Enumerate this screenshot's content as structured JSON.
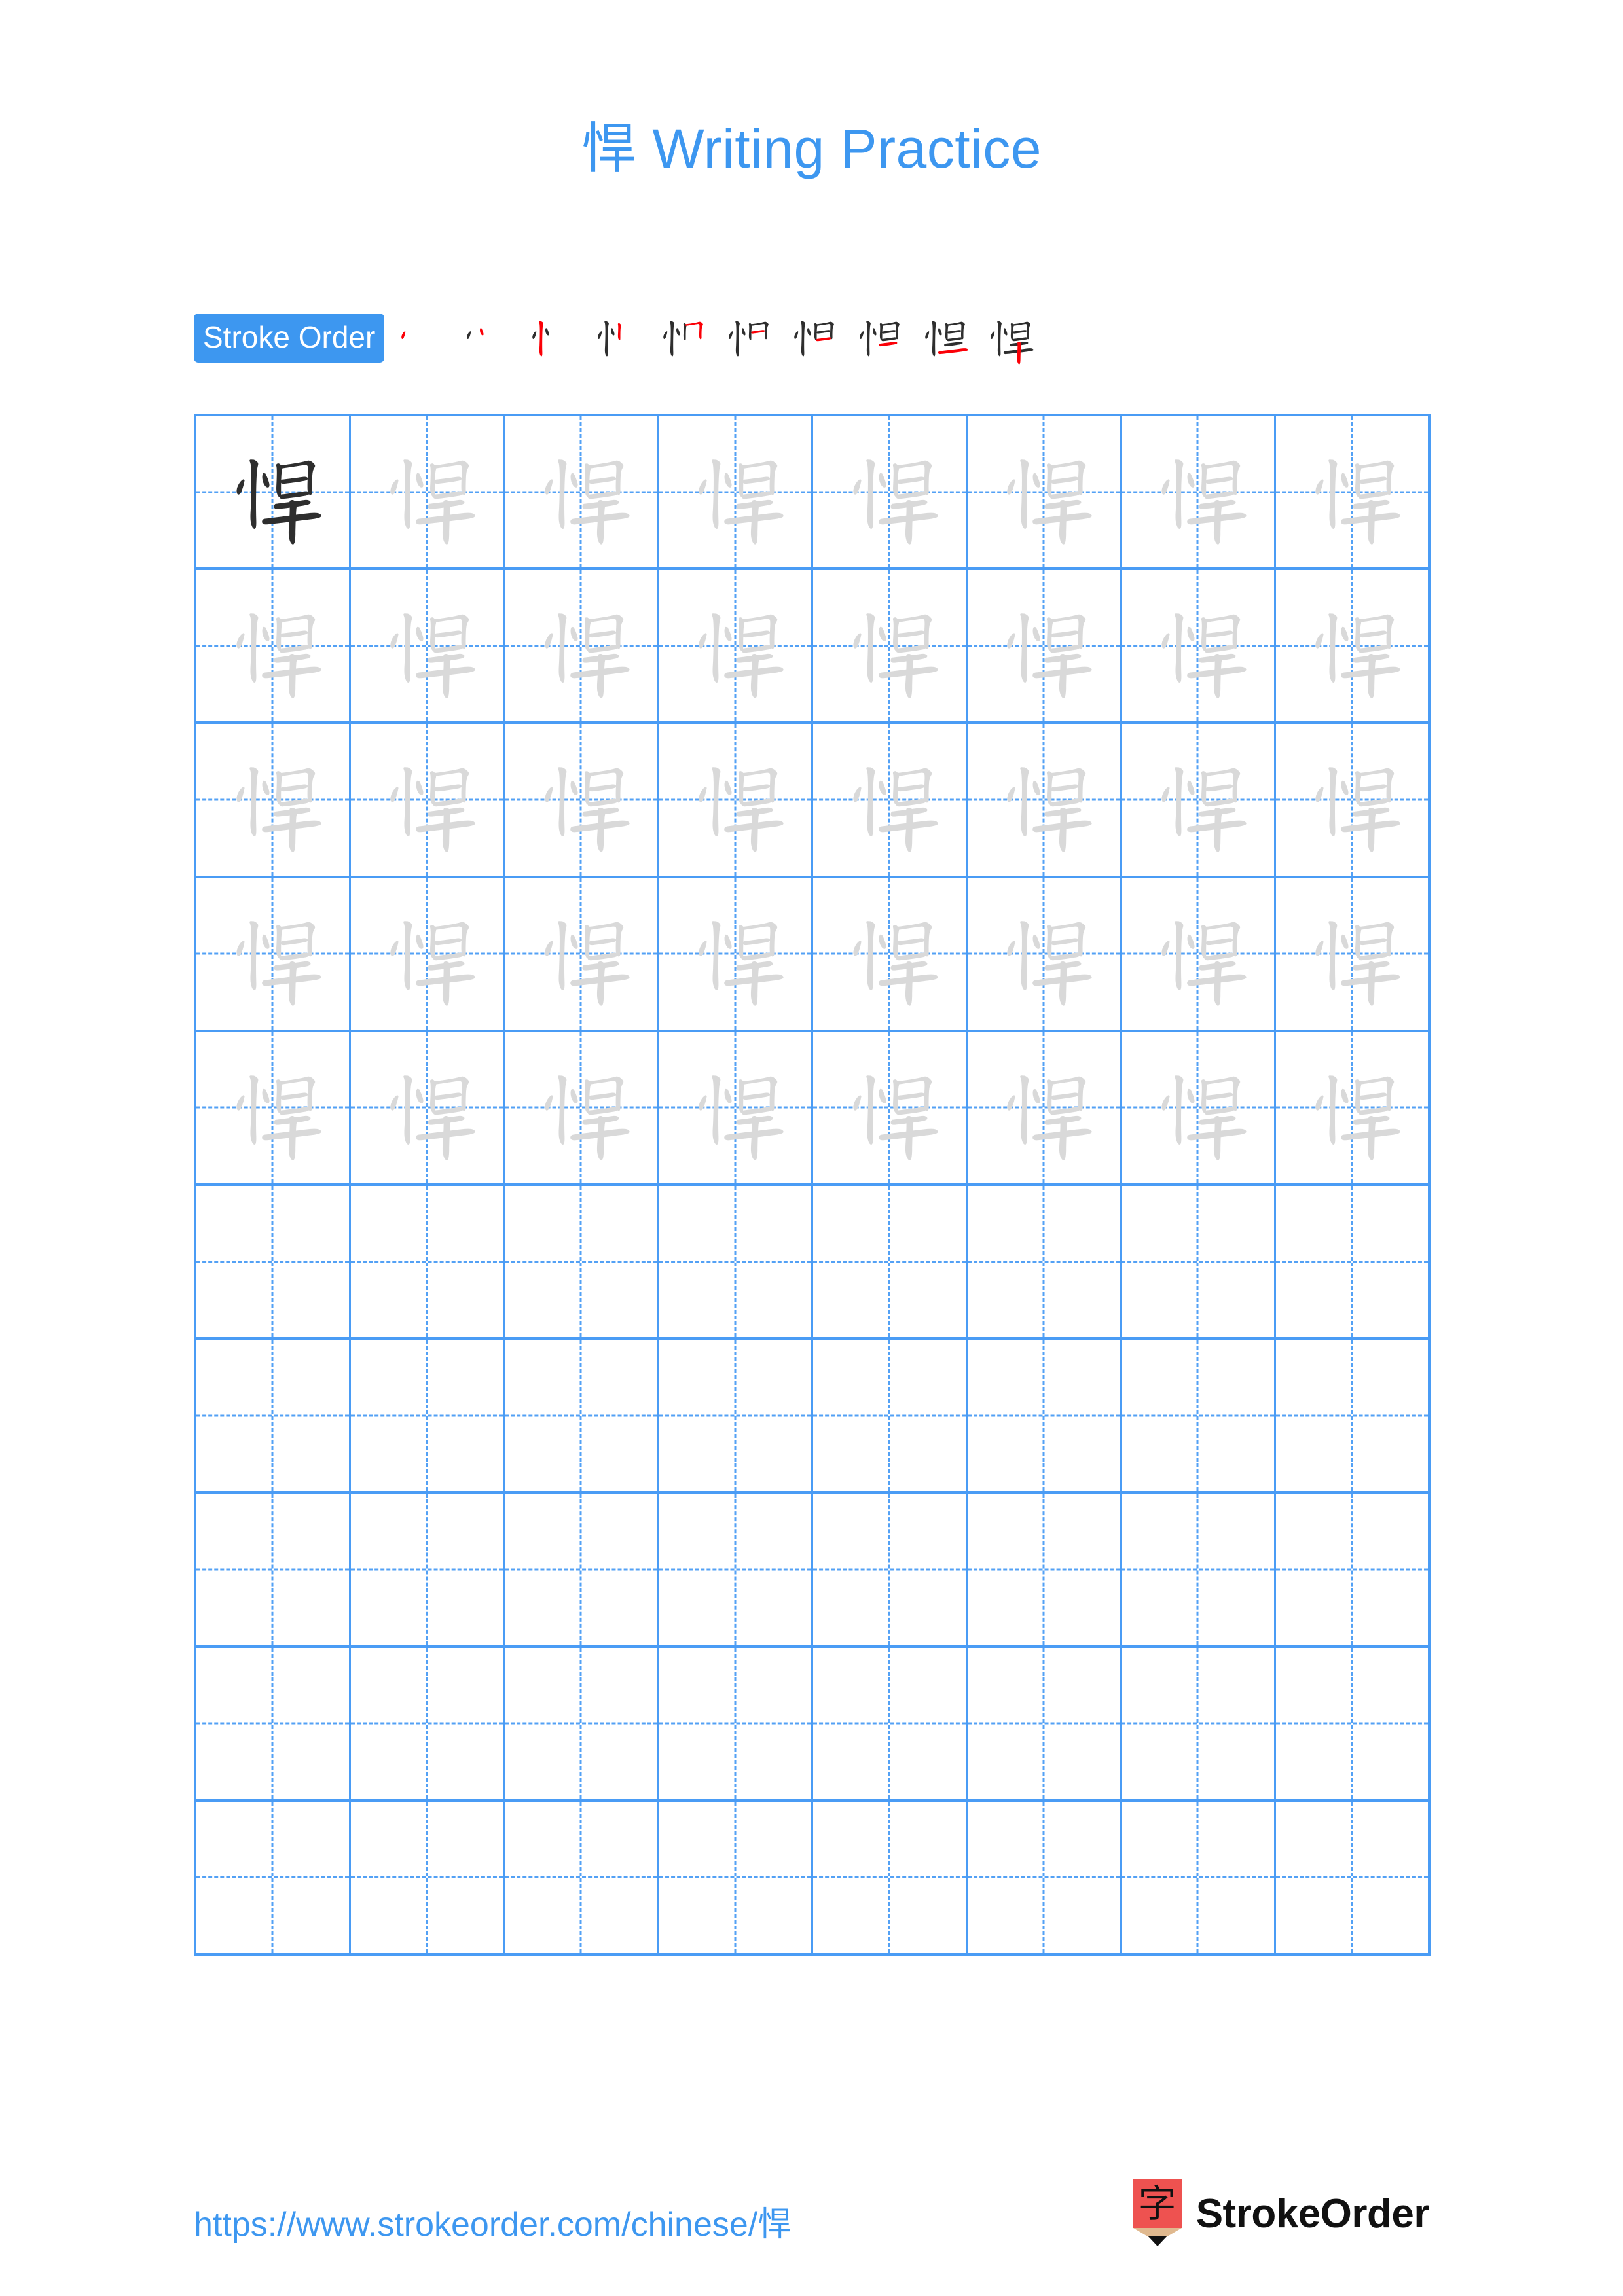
{
  "document": {
    "character": "悍",
    "title_suffix": " Writing Practice",
    "title_full": "悍 Writing Practice",
    "accent_color": "#3d97f0",
    "grid_line_color": "#4a9cf5",
    "trace_color": "#d9d9d9",
    "ink_color": "#2e2e2e",
    "highlight_stroke_color": "#fb0007",
    "background_color": "#ffffff"
  },
  "stroke_order": {
    "label": "Stroke Order",
    "total_strokes": 10,
    "steps": [
      {
        "index": 1,
        "name": "stroke-step-1",
        "strokes_shown": 1
      },
      {
        "index": 2,
        "name": "stroke-step-2",
        "strokes_shown": 2
      },
      {
        "index": 3,
        "name": "stroke-step-3",
        "strokes_shown": 3
      },
      {
        "index": 4,
        "name": "stroke-step-4",
        "strokes_shown": 4
      },
      {
        "index": 5,
        "name": "stroke-step-5",
        "strokes_shown": 5
      },
      {
        "index": 6,
        "name": "stroke-step-6",
        "strokes_shown": 6
      },
      {
        "index": 7,
        "name": "stroke-step-7",
        "strokes_shown": 7
      },
      {
        "index": 8,
        "name": "stroke-step-8",
        "strokes_shown": 8
      },
      {
        "index": 9,
        "name": "stroke-step-9",
        "strokes_shown": 9
      },
      {
        "index": 10,
        "name": "stroke-step-10",
        "strokes_shown": 10
      }
    ]
  },
  "grid": {
    "columns": 8,
    "rows": 10,
    "rows_data": [
      {
        "row": 1,
        "cells": [
          "ink",
          "trace",
          "trace",
          "trace",
          "trace",
          "trace",
          "trace",
          "trace"
        ]
      },
      {
        "row": 2,
        "cells": [
          "trace",
          "trace",
          "trace",
          "trace",
          "trace",
          "trace",
          "trace",
          "trace"
        ]
      },
      {
        "row": 3,
        "cells": [
          "trace",
          "trace",
          "trace",
          "trace",
          "trace",
          "trace",
          "trace",
          "trace"
        ]
      },
      {
        "row": 4,
        "cells": [
          "trace",
          "trace",
          "trace",
          "trace",
          "trace",
          "trace",
          "trace",
          "trace"
        ]
      },
      {
        "row": 5,
        "cells": [
          "trace",
          "trace",
          "trace",
          "trace",
          "trace",
          "trace",
          "trace",
          "trace"
        ]
      },
      {
        "row": 6,
        "cells": [
          "empty",
          "empty",
          "empty",
          "empty",
          "empty",
          "empty",
          "empty",
          "empty"
        ]
      },
      {
        "row": 7,
        "cells": [
          "empty",
          "empty",
          "empty",
          "empty",
          "empty",
          "empty",
          "empty",
          "empty"
        ]
      },
      {
        "row": 8,
        "cells": [
          "empty",
          "empty",
          "empty",
          "empty",
          "empty",
          "empty",
          "empty",
          "empty"
        ]
      },
      {
        "row": 9,
        "cells": [
          "empty",
          "empty",
          "empty",
          "empty",
          "empty",
          "empty",
          "empty",
          "empty"
        ]
      },
      {
        "row": 10,
        "cells": [
          "empty",
          "empty",
          "empty",
          "empty",
          "empty",
          "empty",
          "empty",
          "empty"
        ]
      }
    ]
  },
  "footer": {
    "url": "https://www.strokeorder.com/chinese/悍",
    "brand_name": "StrokeOrder",
    "logo_glyph": "字",
    "logo_body_color": "#ee5250",
    "logo_wood_color": "#e0b98f",
    "logo_tip_color": "#111111"
  }
}
